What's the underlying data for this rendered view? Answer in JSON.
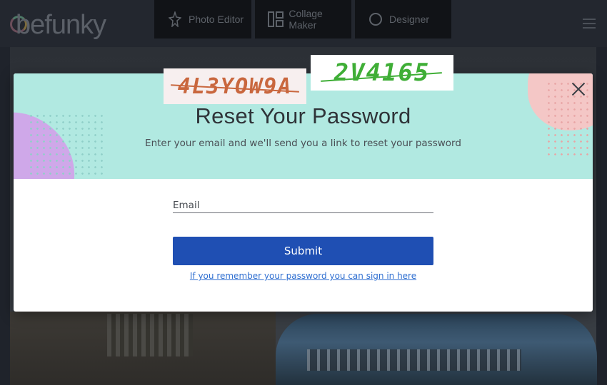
{
  "app": {
    "logo_text": "befunky"
  },
  "nav": {
    "tabs": [
      {
        "label": "Photo Editor",
        "icon": "star-icon"
      },
      {
        "label": "Collage Maker",
        "icon": "collage-icon"
      },
      {
        "label": "Designer",
        "icon": "designer-icon"
      }
    ],
    "menu_icon": "hamburger-icon"
  },
  "captchas": [
    {
      "text": "4L3YOW9A",
      "color": "#c9673e"
    },
    {
      "text": "2V4165",
      "color": "#3fae36"
    }
  ],
  "modal": {
    "title": "Reset Your Password",
    "subtitle": "Enter your email and we'll send you a link to reset your password",
    "email_label": "Email",
    "email_value": "",
    "submit_label": "Submit",
    "signin_link": "If you remember your password you can sign in here",
    "close_icon": "close-icon"
  },
  "colors": {
    "header_bg": "#b1e9e1",
    "button_bg": "#1f4fb3",
    "link": "#2f6fd1"
  }
}
